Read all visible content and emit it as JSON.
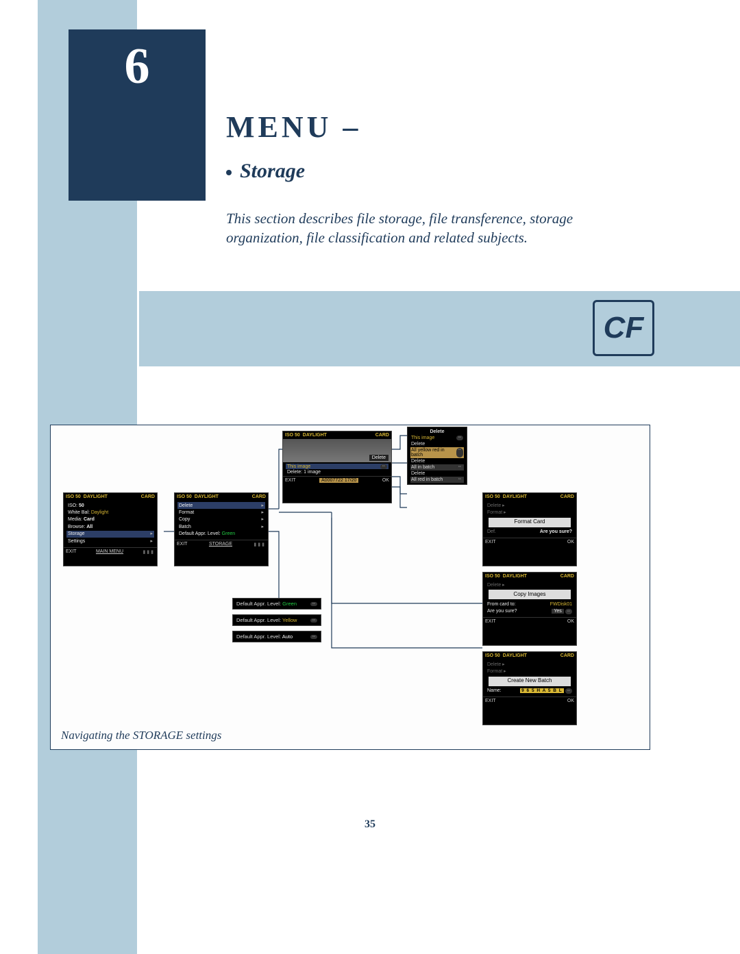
{
  "chapter_number": "6",
  "menu_title": "Menu –",
  "storage_label": "Storage",
  "intro_text": "This section describes file storage, file transference, storage organization, file classification and related subjects.",
  "cf_label": "CF",
  "diagram_caption": "Navigating the STORAGE settings",
  "page_number": "35",
  "lcd_header": {
    "iso": "ISO 50",
    "wb": "DAYLIGHT",
    "media": "CARD"
  },
  "main_menu": {
    "items": [
      {
        "label": "ISO:",
        "value": "50"
      },
      {
        "label": "White Bal:",
        "value": "Daylight"
      },
      {
        "label": "Media:",
        "value": "Card"
      },
      {
        "label": "Browse:",
        "value": "All"
      },
      {
        "label": "Storage",
        "arrow": true,
        "selected": true
      },
      {
        "label": "Settings",
        "arrow": true
      }
    ],
    "foot_left": "EXIT",
    "foot_center": "MAIN MENU"
  },
  "storage_menu": {
    "items": [
      {
        "label": "Delete",
        "arrow": true,
        "selected": true
      },
      {
        "label": "Format",
        "arrow": true
      },
      {
        "label": "Copy",
        "arrow": true
      },
      {
        "label": "Batch",
        "arrow": true
      },
      {
        "label": "Default Appr. Level:",
        "value": "Green"
      }
    ],
    "foot_left": "EXIT",
    "foot_center": "STORAGE"
  },
  "delete_preview": {
    "title": "Delete",
    "sub1": "This image",
    "sub2": "Delete: 1 image",
    "foot_left": "EXIT",
    "foot_mid": "A0007722    17/20",
    "foot_right": "OK"
  },
  "delete_options": {
    "title": "Delete",
    "rows": [
      {
        "label": "This image"
      },
      {
        "label": "Delete"
      },
      {
        "label": "All yellow red in batch"
      },
      {
        "label": "Delete"
      },
      {
        "label": "All in batch"
      },
      {
        "label": "Delete"
      },
      {
        "label": "All red in batch"
      }
    ]
  },
  "appr_levels": [
    {
      "label": "Default Appr. Level:",
      "value": "Green",
      "cls": "lv-g"
    },
    {
      "label": "Default Appr. Level:",
      "value": "Yellow",
      "cls": "lv-y"
    },
    {
      "label": "Default Appr. Level:",
      "value": "Auto",
      "cls": "lv-a"
    }
  ],
  "format_card": {
    "dim1": "Delete ▸",
    "dim2": "Format ▸",
    "title": "Format Card",
    "confirm_prefix": "Def.",
    "confirm": "Are you sure?",
    "foot_left": "EXIT",
    "foot_right": "OK"
  },
  "copy_images": {
    "dim1": "Delete ▸",
    "title": "Copy Images",
    "line1a": "From card to:",
    "line1b": "FWDisk01",
    "line2a": "Are you sure?",
    "line2b": "Yes",
    "foot_left": "EXIT",
    "foot_right": "OK"
  },
  "create_batch": {
    "dim1": "Delete ▸",
    "dim2": "Format ▸",
    "title": "Create New Batch",
    "name_label": "Name:",
    "name_value": "9 6 5 H A 5 B L",
    "foot_left": "EXIT",
    "foot_right": "OK"
  }
}
